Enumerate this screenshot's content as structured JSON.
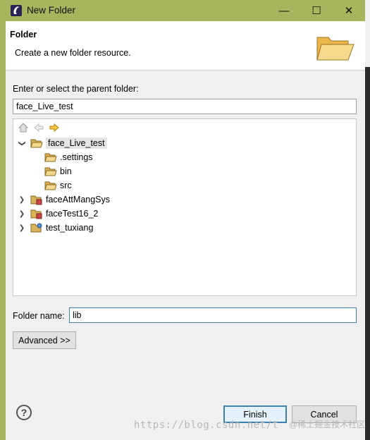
{
  "window": {
    "title": "New Folder"
  },
  "banner": {
    "title": "Folder",
    "description": "Create a new folder resource."
  },
  "parent": {
    "label": "Enter or select the parent folder:",
    "value": "face_Live_test"
  },
  "tree": {
    "items": [
      {
        "label": "face_Live_test",
        "expanded": true,
        "icon": "open-folder-project-icon",
        "selected": true
      },
      {
        "label": ".settings",
        "icon": "folder-icon"
      },
      {
        "label": "bin",
        "icon": "folder-icon"
      },
      {
        "label": "src",
        "icon": "folder-icon"
      },
      {
        "label": "faceAttMangSys",
        "expanded": false,
        "icon": "project-icon"
      },
      {
        "label": "faceTest16_2",
        "expanded": false,
        "icon": "project-icon"
      },
      {
        "label": "test_tuxiang",
        "expanded": false,
        "icon": "project-icon"
      }
    ]
  },
  "folder_name": {
    "label": "Folder name:",
    "value": "lib"
  },
  "buttons": {
    "advanced": "Advanced >>",
    "finish": "Finish",
    "cancel": "Cancel"
  },
  "help": {
    "symbol": "?"
  },
  "titlebar_controls": {
    "minimize": "—",
    "maximize": "☐",
    "close": "✕"
  },
  "watermark": {
    "url": "https://blog.csdn.net/t",
    "source": "@稀土掘金技术社区"
  },
  "colors": {
    "frame": "#a9b55c",
    "focus": "#3c7fb1",
    "selected": "#e4e4e4"
  }
}
